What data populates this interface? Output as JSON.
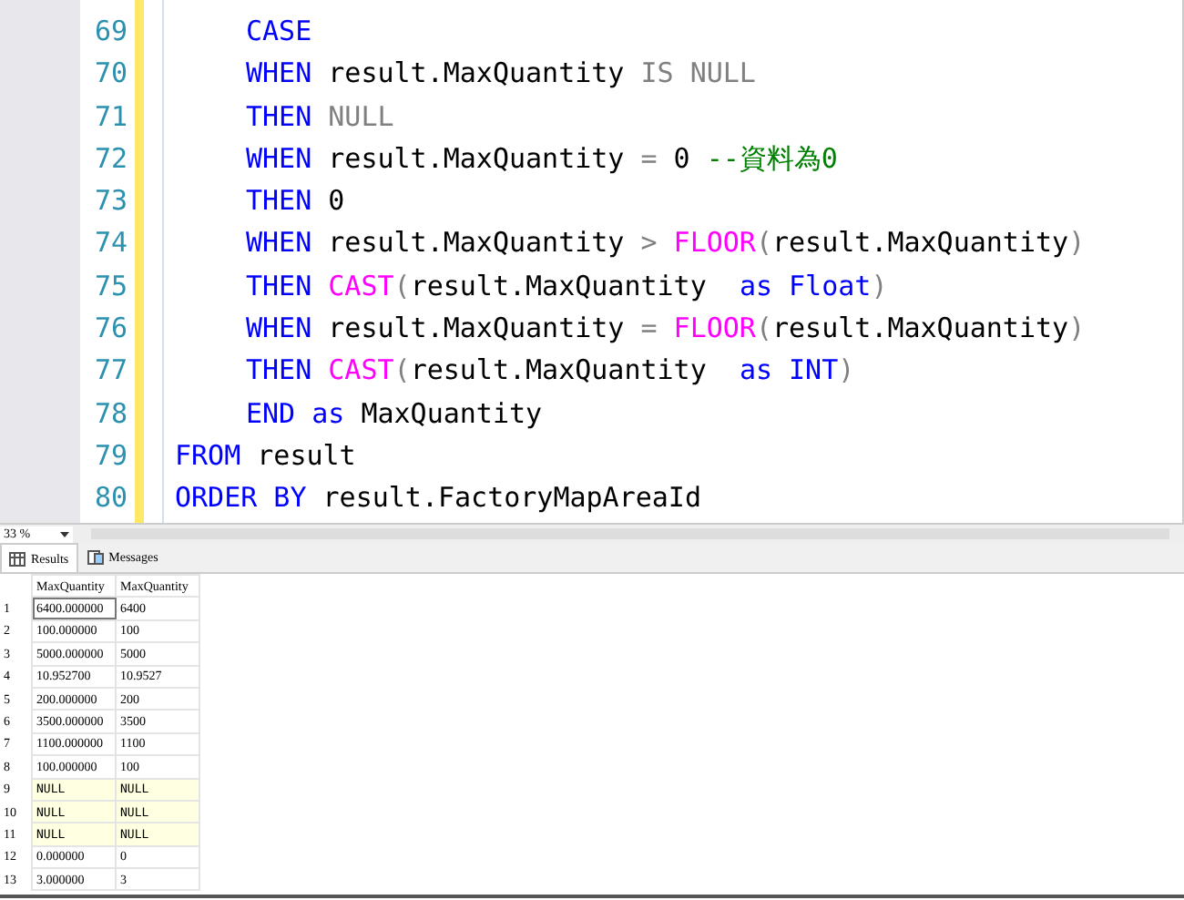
{
  "editor": {
    "lines": [
      {
        "number": "69",
        "indented": true,
        "tokens": [
          {
            "kind": "keyword",
            "text": "CASE"
          }
        ]
      },
      {
        "number": "70",
        "indented": true,
        "tokens": [
          {
            "kind": "keyword",
            "text": "WHEN"
          },
          {
            "kind": "plain",
            "text": " result.MaxQuantity "
          },
          {
            "kind": "gray",
            "text": "IS NULL"
          }
        ]
      },
      {
        "number": "71",
        "indented": true,
        "tokens": [
          {
            "kind": "keyword",
            "text": "THEN"
          },
          {
            "kind": "gray",
            "text": " NULL"
          }
        ]
      },
      {
        "number": "72",
        "indented": true,
        "tokens": [
          {
            "kind": "keyword",
            "text": "WHEN"
          },
          {
            "kind": "plain",
            "text": " result.MaxQuantity "
          },
          {
            "kind": "gray",
            "text": "="
          },
          {
            "kind": "plain",
            "text": " 0 "
          },
          {
            "kind": "comment",
            "text": "--資料為0"
          }
        ]
      },
      {
        "number": "73",
        "indented": true,
        "tokens": [
          {
            "kind": "keyword",
            "text": "THEN"
          },
          {
            "kind": "plain",
            "text": " 0"
          }
        ]
      },
      {
        "number": "74",
        "indented": true,
        "tokens": [
          {
            "kind": "keyword",
            "text": "WHEN"
          },
          {
            "kind": "plain",
            "text": " result.MaxQuantity "
          },
          {
            "kind": "gray",
            "text": ">"
          },
          {
            "kind": "function",
            "text": " FLOOR"
          },
          {
            "kind": "gray",
            "text": "("
          },
          {
            "kind": "plain",
            "text": "result.MaxQuantity"
          },
          {
            "kind": "gray",
            "text": ")"
          }
        ]
      },
      {
        "number": "75",
        "indented": true,
        "tokens": [
          {
            "kind": "keyword",
            "text": "THEN"
          },
          {
            "kind": "function",
            "text": " CAST"
          },
          {
            "kind": "gray",
            "text": "("
          },
          {
            "kind": "plain",
            "text": "result.MaxQuantity  "
          },
          {
            "kind": "keyword",
            "text": "as Float"
          },
          {
            "kind": "gray",
            "text": ")"
          }
        ]
      },
      {
        "number": "76",
        "indented": true,
        "tokens": [
          {
            "kind": "keyword",
            "text": "WHEN"
          },
          {
            "kind": "plain",
            "text": " result.MaxQuantity "
          },
          {
            "kind": "gray",
            "text": "="
          },
          {
            "kind": "function",
            "text": " FLOOR"
          },
          {
            "kind": "gray",
            "text": "("
          },
          {
            "kind": "plain",
            "text": "result.MaxQuantity"
          },
          {
            "kind": "gray",
            "text": ")"
          }
        ]
      },
      {
        "number": "77",
        "indented": true,
        "tokens": [
          {
            "kind": "keyword",
            "text": "THEN"
          },
          {
            "kind": "function",
            "text": " CAST"
          },
          {
            "kind": "gray",
            "text": "("
          },
          {
            "kind": "plain",
            "text": "result.MaxQuantity  "
          },
          {
            "kind": "keyword",
            "text": "as INT"
          },
          {
            "kind": "gray",
            "text": ")"
          }
        ]
      },
      {
        "number": "78",
        "indented": true,
        "tokens": [
          {
            "kind": "keyword",
            "text": "END as"
          },
          {
            "kind": "plain",
            "text": " MaxQuantity"
          }
        ]
      },
      {
        "number": "79",
        "indented": false,
        "tokens": [
          {
            "kind": "keyword",
            "text": "FROM"
          },
          {
            "kind": "plain",
            "text": " result"
          }
        ]
      },
      {
        "number": "80",
        "indented": false,
        "tokens": [
          {
            "kind": "keyword",
            "text": "ORDER BY"
          },
          {
            "kind": "plain",
            "text": " result.FactoryMapAreaId"
          }
        ]
      }
    ]
  },
  "zoom": {
    "value": "33 %"
  },
  "tabs": [
    {
      "label": "Results",
      "selected": true
    },
    {
      "label": "Messages",
      "selected": false
    }
  ],
  "grid": {
    "columns": [
      "MaxQuantity",
      "MaxQuantity"
    ],
    "rows": [
      {
        "number": "1",
        "cells": [
          "6400.000000",
          "6400"
        ],
        "null": false,
        "selected": true
      },
      {
        "number": "2",
        "cells": [
          "100.000000",
          "100"
        ],
        "null": false,
        "selected": false
      },
      {
        "number": "3",
        "cells": [
          "5000.000000",
          "5000"
        ],
        "null": false,
        "selected": false
      },
      {
        "number": "4",
        "cells": [
          "10.952700",
          "10.9527"
        ],
        "null": false,
        "selected": false
      },
      {
        "number": "5",
        "cells": [
          "200.000000",
          "200"
        ],
        "null": false,
        "selected": false
      },
      {
        "number": "6",
        "cells": [
          "3500.000000",
          "3500"
        ],
        "null": false,
        "selected": false
      },
      {
        "number": "7",
        "cells": [
          "1100.000000",
          "1100"
        ],
        "null": false,
        "selected": false
      },
      {
        "number": "8",
        "cells": [
          "100.000000",
          "100"
        ],
        "null": false,
        "selected": false
      },
      {
        "number": "9",
        "cells": [
          "NULL",
          "NULL"
        ],
        "null": true,
        "selected": false
      },
      {
        "number": "10",
        "cells": [
          "NULL",
          "NULL"
        ],
        "null": true,
        "selected": false
      },
      {
        "number": "11",
        "cells": [
          "NULL",
          "NULL"
        ],
        "null": true,
        "selected": false
      },
      {
        "number": "12",
        "cells": [
          "0.000000",
          "0"
        ],
        "null": false,
        "selected": false
      },
      {
        "number": "13",
        "cells": [
          "3.000000",
          "3"
        ],
        "null": false,
        "selected": false
      }
    ]
  }
}
